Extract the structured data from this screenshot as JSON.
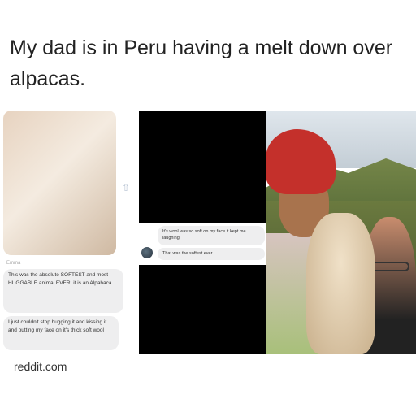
{
  "caption": "My dad is in Peru having a melt down over alpacas.",
  "left_chat": {
    "sender": "Emma",
    "bubble1": "This was the absolute SOFTEST and most HUGGABLE animal EVER. it is an Alpahaca",
    "bubble2": "I just couldn't stop hugging it and kissing it and putting my face on it's thick soft wool"
  },
  "center_chat": {
    "bubble1": "It's wool was so soft on my face it kept me laughing",
    "bubble2": "That was the softest ever"
  },
  "source": "reddit.com"
}
